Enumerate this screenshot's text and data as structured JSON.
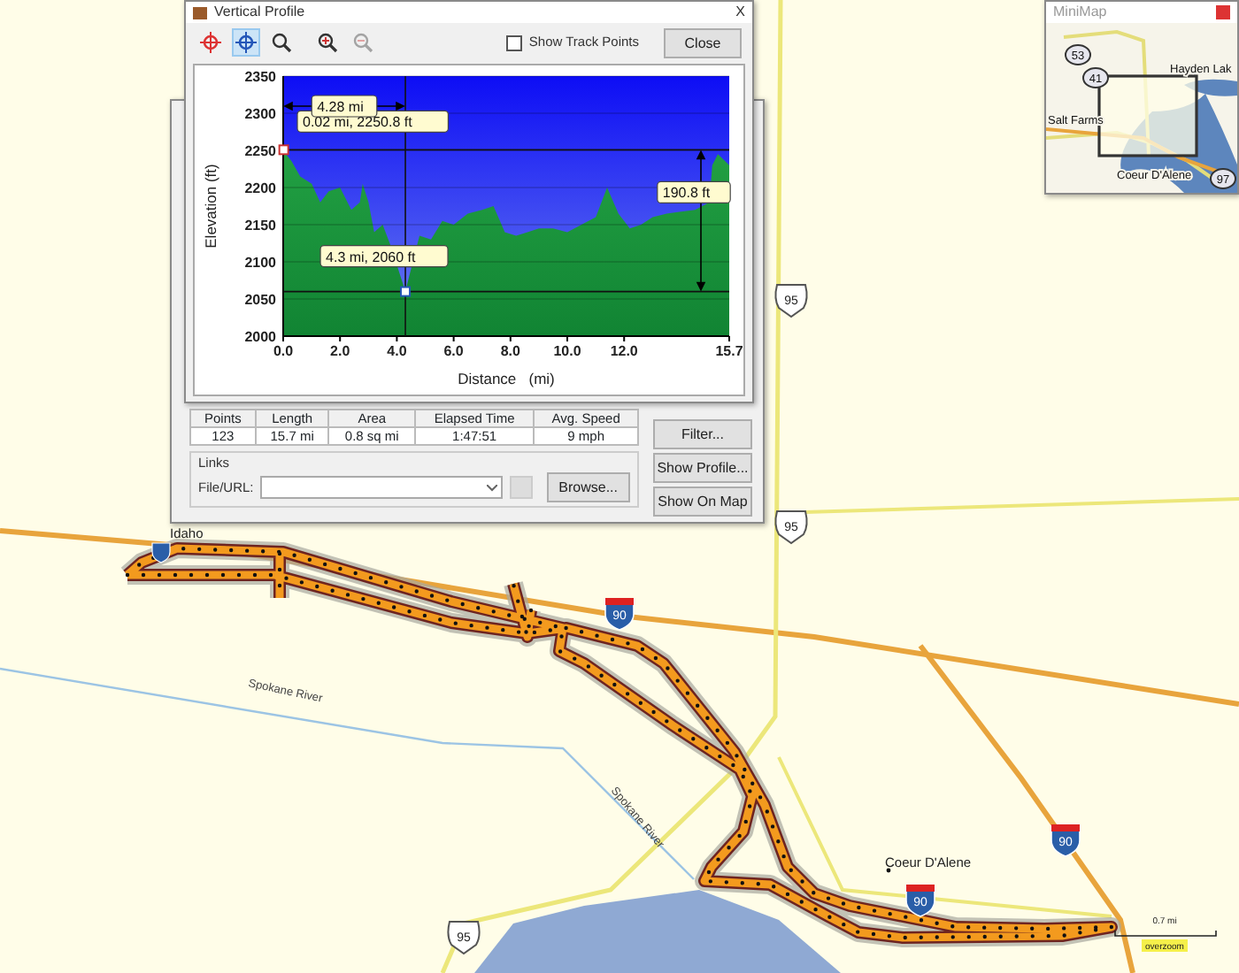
{
  "profile_window": {
    "title": "Vertical Profile",
    "close_glyph": "X",
    "tools": [
      {
        "kind": "target",
        "selected": false,
        "disabled": false
      },
      {
        "kind": "crosshair",
        "selected": true,
        "disabled": false
      },
      {
        "kind": "zoom-region",
        "selected": false,
        "disabled": false
      },
      {
        "kind": "zoom-in",
        "selected": false,
        "disabled": false
      },
      {
        "kind": "zoom-out",
        "selected": false,
        "disabled": true
      }
    ],
    "show_track_points": {
      "label": "Show Track Points",
      "checked": false
    },
    "close_button": "Close",
    "chart": {
      "chart_data": {
        "type": "area",
        "xlabel": "Distance   (mi)",
        "ylabel": "Elevation (ft)",
        "x": [
          0,
          0.3,
          0.6,
          1.0,
          1.3,
          1.6,
          2.0,
          2.4,
          2.7,
          2.8,
          3.0,
          3.2,
          3.5,
          3.8,
          4.3,
          4.8,
          5.2,
          5.6,
          6.0,
          6.5,
          7.0,
          7.4,
          7.8,
          8.2,
          8.6,
          9.0,
          9.5,
          10.0,
          10.5,
          11.0,
          11.4,
          11.8,
          12.2,
          12.6,
          13.0,
          13.5,
          14.5,
          15.0,
          15.1,
          15.3,
          15.7
        ],
        "series": [
          {
            "color": "#22a043",
            "values": [
              2250,
              2235,
              2215,
              2205,
              2180,
              2195,
              2200,
              2170,
              2180,
              2205,
              2180,
              2140,
              2150,
              2120,
              2060,
              2135,
              2130,
              2155,
              2150,
              2165,
              2170,
              2175,
              2140,
              2135,
              2140,
              2145,
              2145,
              2140,
              2150,
              2160,
              2200,
              2165,
              2145,
              2150,
              2160,
              2165,
              2170,
              2180,
              2230,
              2245,
              2230
            ]
          }
        ],
        "grid": true,
        "xlim": [
          0,
          15.7
        ],
        "ylim": [
          2000,
          2350
        ],
        "xticks": [
          {
            "value": 0,
            "label": "0.0"
          },
          {
            "value": 2,
            "label": "2.0"
          },
          {
            "value": 4,
            "label": "4.0"
          },
          {
            "value": 6,
            "label": "6.0"
          },
          {
            "value": 8,
            "label": "8.0"
          },
          {
            "value": 10,
            "label": "10.0"
          },
          {
            "value": 12,
            "label": "12.0"
          },
          {
            "value": 15.7,
            "label": "15.7"
          }
        ],
        "yticks": [
          2000,
          2050,
          2100,
          2150,
          2200,
          2250,
          2300,
          2350
        ],
        "annotations": [
          "4.28 mi",
          {
            "text": "0.02 mi, 2250.8 ft",
            "x": 0.02,
            "y": 2250.8
          },
          {
            "text": "4.3 mi, 2060 ft",
            "x": 4.3,
            "y": 2060
          },
          "190.8 ft"
        ]
      }
    }
  },
  "properties_window": {
    "stats": {
      "columns": [
        "Points",
        "Length",
        "Area",
        "Elapsed Time",
        "Avg. Speed"
      ],
      "values": [
        "123",
        "15.7 mi",
        "0.8 sq mi",
        "1:47:51",
        "9 mph"
      ]
    },
    "links": {
      "title": "Links",
      "label": "File/URL:",
      "browse": "Browse..."
    },
    "buttons": [
      "Filter...",
      "Show Profile...",
      "Show On Map"
    ]
  },
  "minimap": {
    "title": "MiniMap",
    "labels": [
      "Hayden Lak",
      "Salt Farms",
      "Coeur D'Alene"
    ],
    "shields": [
      "53",
      "41",
      "97"
    ]
  },
  "map": {
    "place_labels": [
      "Idaho",
      "Coeur D'Alene"
    ],
    "river_labels": [
      "Spokane River",
      "Spokane River"
    ],
    "shields": [
      {
        "kind": "us",
        "number": "95"
      },
      {
        "kind": "us",
        "number": "95"
      },
      {
        "kind": "us",
        "number": "95"
      },
      {
        "kind": "interstate",
        "number": "90"
      },
      {
        "kind": "interstate",
        "number": "90"
      },
      {
        "kind": "interstate",
        "number": "90"
      },
      {
        "kind": "interstate_small"
      }
    ],
    "scale": {
      "distance": "0.7 mi",
      "mode": "overzoom"
    }
  }
}
